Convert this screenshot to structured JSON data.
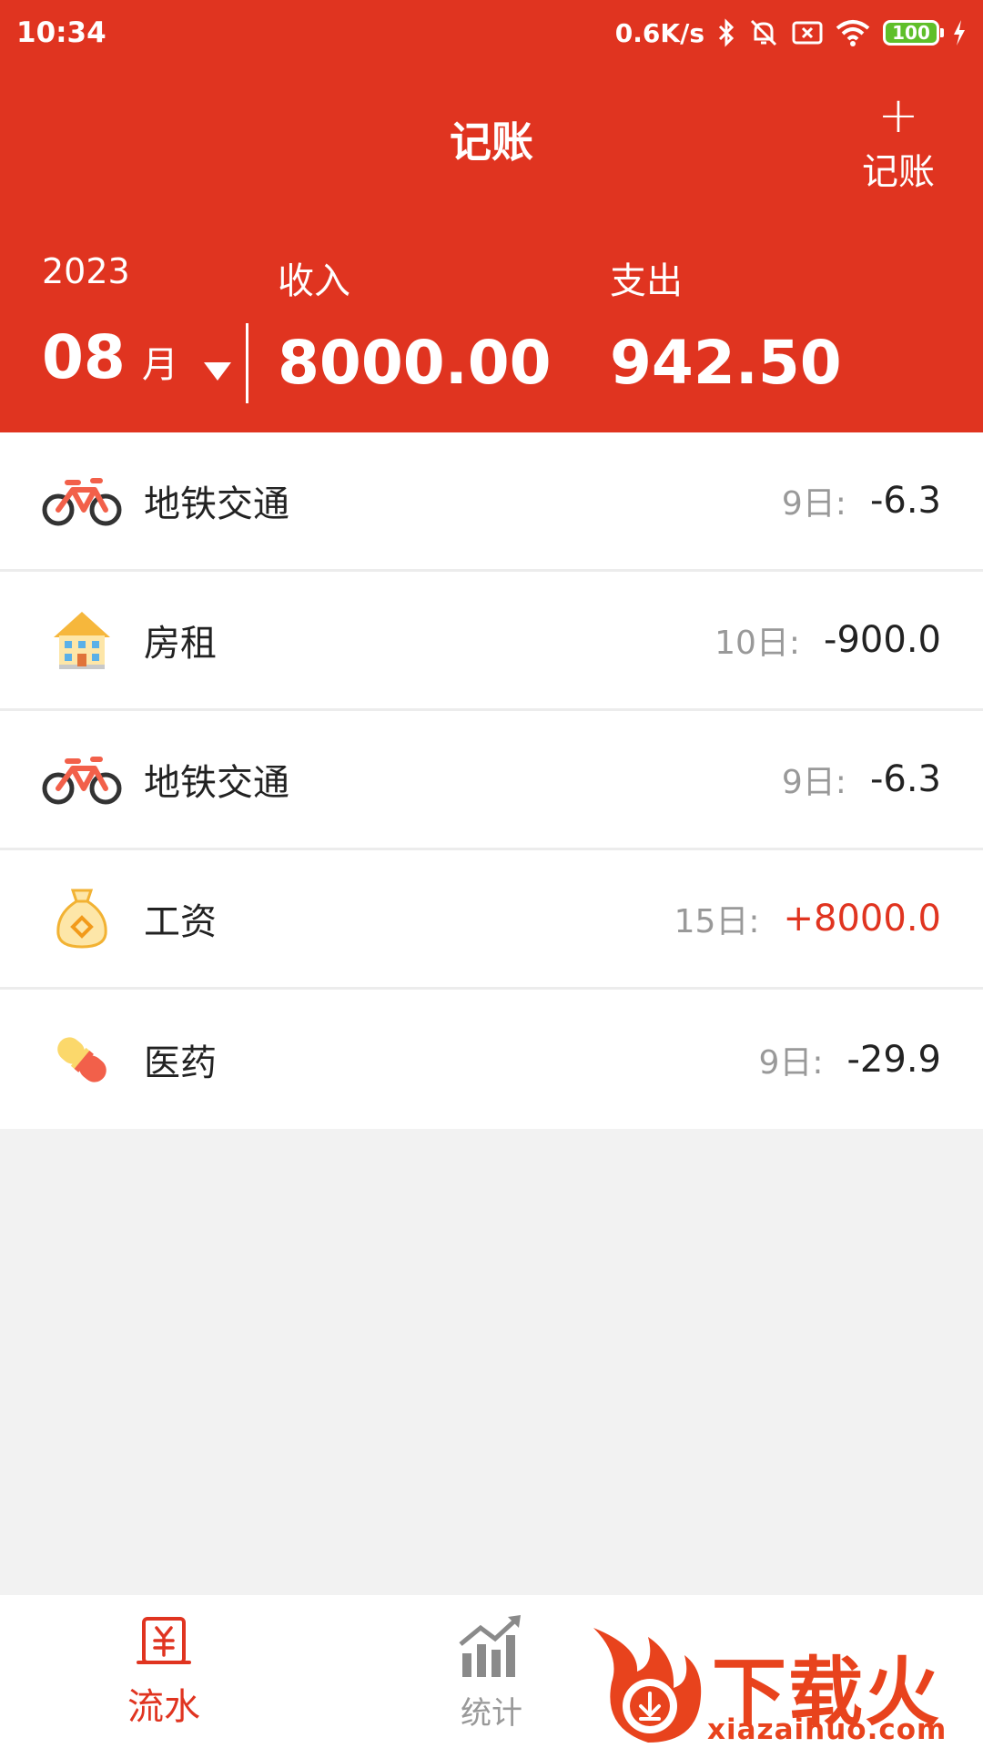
{
  "status_bar": {
    "time": "10:34",
    "net_speed": "0.6K/s",
    "battery": "100"
  },
  "header": {
    "title": "记账",
    "add_label": "记账",
    "year": "2023",
    "month": "08",
    "month_unit": "月",
    "income_label": "收入",
    "income_value": "8000.00",
    "expense_label": "支出",
    "expense_value": "942.50"
  },
  "records": [
    {
      "icon": "bicycle-icon",
      "name": "地铁交通",
      "date": "9日:",
      "amount": "-6.3",
      "type": "expense"
    },
    {
      "icon": "house-icon",
      "name": "房租",
      "date": "10日:",
      "amount": "-900.0",
      "type": "expense"
    },
    {
      "icon": "bicycle-icon",
      "name": "地铁交通",
      "date": "9日:",
      "amount": "-6.3",
      "type": "expense"
    },
    {
      "icon": "money-bag-icon",
      "name": "工资",
      "date": "15日:",
      "amount": "+8000.0",
      "type": "income"
    },
    {
      "icon": "pill-icon",
      "name": "医药",
      "date": "9日:",
      "amount": "-29.9",
      "type": "expense"
    }
  ],
  "bottom_nav": {
    "flow_label": "流水",
    "stats_label": "统计"
  },
  "watermark": {
    "text": "下载火",
    "url": "xiazaihuo.com"
  },
  "colors": {
    "accent": "#e03420",
    "income": "#e03420",
    "muted": "#999999"
  }
}
